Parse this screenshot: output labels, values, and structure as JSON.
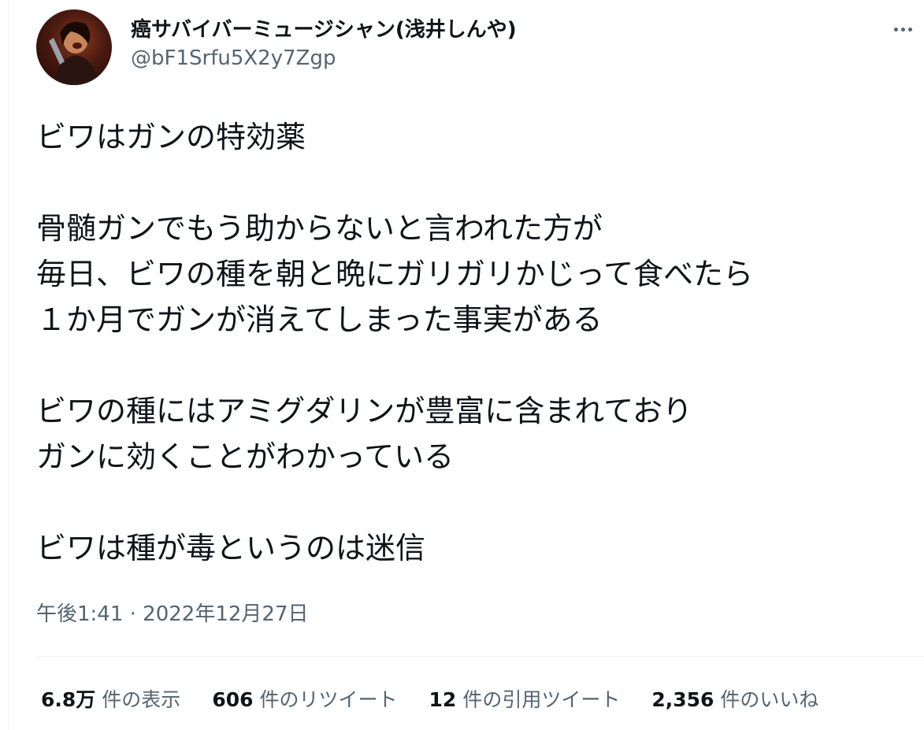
{
  "author": {
    "display_name": "癌サバイバーミュージシャン(浅井しんや)",
    "handle": "@bF1Srfu5X2y7Zgp",
    "avatar_icon": "profile-photo-icon",
    "more_icon": "more-options-icon"
  },
  "tweet": {
    "lines": [
      "ビワはガンの特効薬",
      "",
      "骨髄ガンでもう助からないと言われた方が",
      "毎日、ビワの種を朝と晩にガリガリかじって食べたら",
      "１か月でガンが消えてしまった事実がある",
      "",
      "ビワの種にはアミグダリンが豊富に含まれており",
      "ガンに効くことがわかっている",
      "",
      "ビワは種が毒というのは迷信"
    ],
    "timestamp": "午後1:41 · 2022年12月27日"
  },
  "stats": {
    "views": {
      "value": "6.8万",
      "label": "件の表示"
    },
    "retweets": {
      "value": "606",
      "label": "件のリツイート"
    },
    "quotes": {
      "value": "12",
      "label": "件の引用ツイート"
    },
    "likes": {
      "value": "2,356",
      "label": "件のいいね"
    }
  },
  "colors": {
    "text_primary": "#0f1419",
    "text_secondary": "#536471",
    "divider": "#eff3f4",
    "background": "#ffffff"
  }
}
